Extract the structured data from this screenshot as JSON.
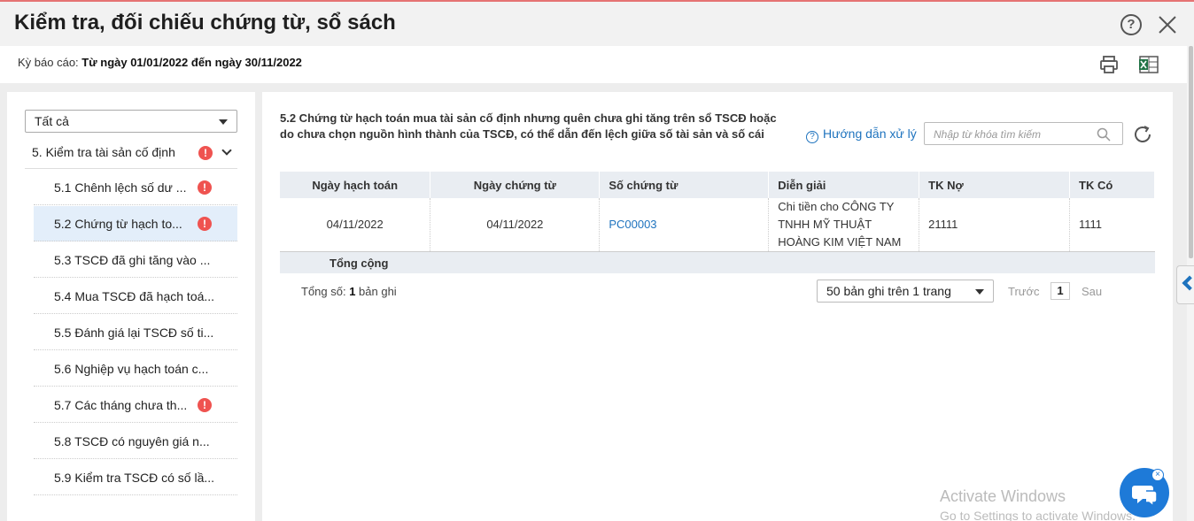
{
  "window": {
    "title": "Kiểm tra, đối chiếu chứng từ, sổ sách"
  },
  "period": {
    "label": "Kỳ báo cáo: ",
    "value": "Từ ngày 01/01/2022 đến ngày 30/11/2022"
  },
  "sidebar": {
    "filter_value": "Tất cả",
    "group": {
      "label": "5. Kiểm tra tài sản cố định",
      "alert": "!"
    },
    "items": [
      {
        "label": "5.1 Chênh lệch số dư ...",
        "alert": "!"
      },
      {
        "label": "5.2 Chứng từ hạch to...",
        "alert": "!"
      },
      {
        "label": "5.3 TSCĐ đã ghi tăng vào ..."
      },
      {
        "label": "5.4 Mua TSCĐ đã hạch toá..."
      },
      {
        "label": "5.5 Đánh giá lại TSCĐ số ti..."
      },
      {
        "label": "5.6 Nghiệp vụ hạch toán c..."
      },
      {
        "label": "5.7 Các tháng chưa th...",
        "alert": "!"
      },
      {
        "label": "5.8 TSCĐ có nguyên giá n..."
      },
      {
        "label": "5.9 Kiểm tra TSCĐ có số lầ..."
      }
    ]
  },
  "main": {
    "description": "5.2 Chứng từ hạch toán mua tài sản cố định nhưng quên chưa ghi tăng trên sổ TSCĐ hoặc do chưa chọn nguồn hình thành của TSCĐ, có thể dẫn đến lệch giữa số tài sản và số cái",
    "guide_label": "Hướng dẫn xử lý",
    "search_placeholder": "Nhập từ khóa tìm kiếm",
    "columns": [
      "Ngày hạch toán",
      "Ngày chứng từ",
      "Số chứng từ",
      "Diễn giải",
      "TK Nợ",
      "TK Có"
    ],
    "rows": [
      {
        "ngay_hach_toan": "04/11/2022",
        "ngay_chung_tu": "04/11/2022",
        "so_chung_tu": "PC00003",
        "dien_giai": "Chi tiền cho CÔNG TY TNHH MỸ THUẬT HOÀNG KIM VIỆT NAM",
        "tk_no": "21111",
        "tk_co": "1111"
      }
    ],
    "total_label": "Tổng cộng",
    "count_prefix": "Tổng số: ",
    "count_value": "1",
    "count_suffix": " bản ghi",
    "page_size": "50 bản ghi trên 1 trang",
    "prev": "Trước",
    "page": "1",
    "next": "Sau"
  },
  "watermark": {
    "line1": "Activate Windows",
    "line2": "Go to Settings to activate Windows."
  },
  "colors": {
    "accent": "#1e73be",
    "alert": "#ef5350",
    "chat": "#1e7ad8"
  },
  "icons": [
    "help-icon",
    "close-icon",
    "print-icon",
    "excel-icon",
    "chevron-down-icon",
    "info-icon",
    "search-icon",
    "refresh-icon",
    "chevron-left-icon",
    "chat-icon"
  ]
}
